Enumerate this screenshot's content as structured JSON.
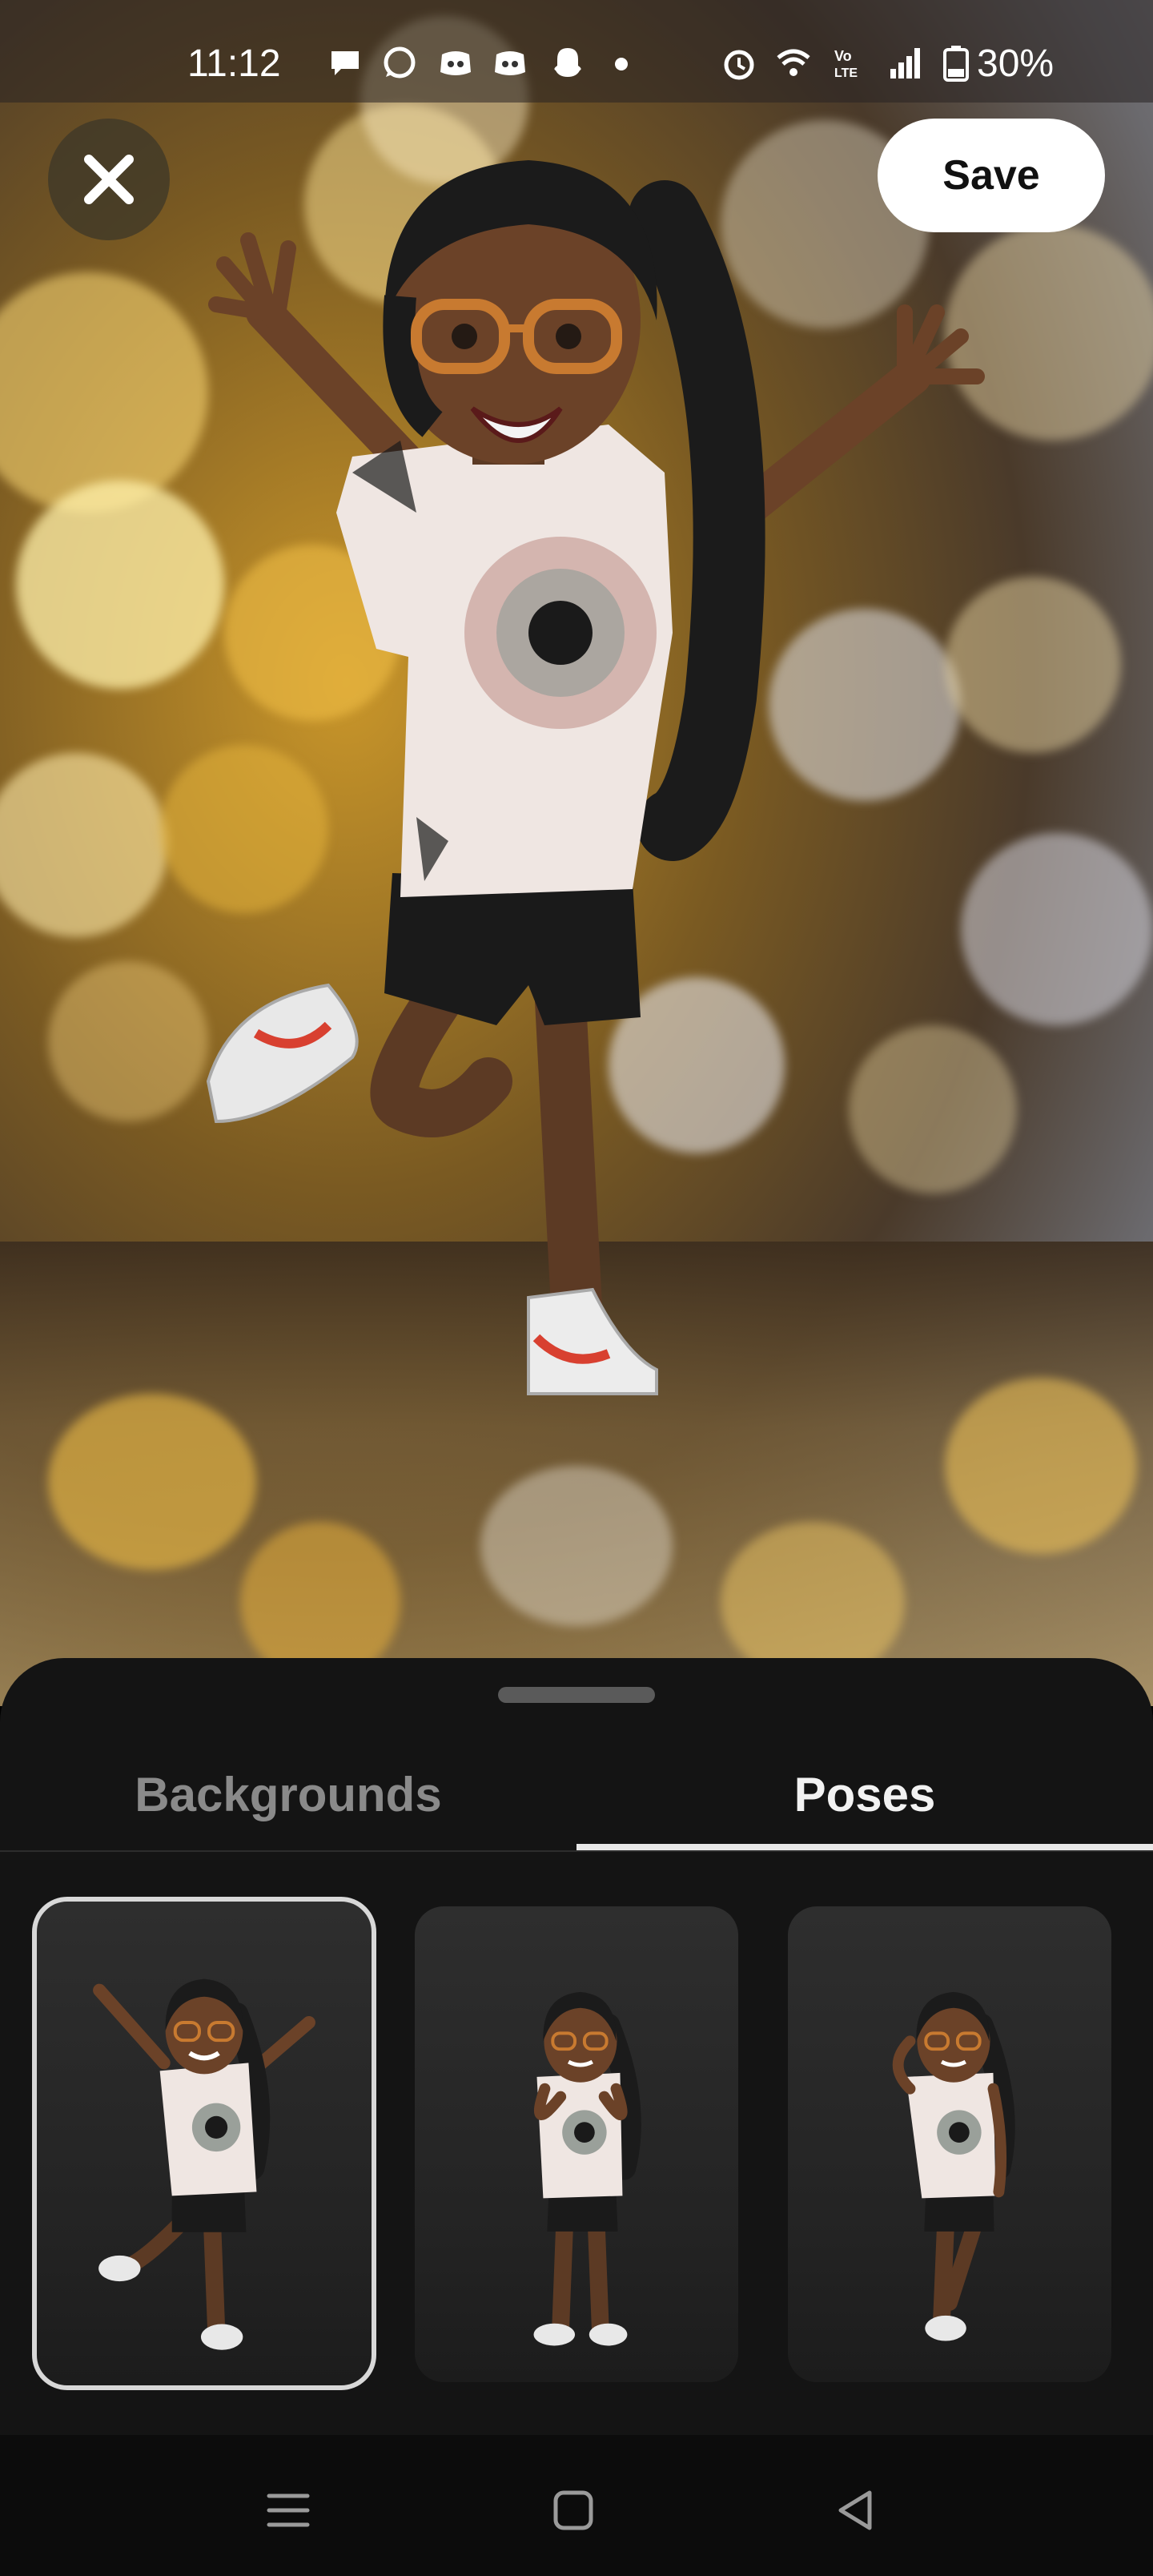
{
  "status_bar": {
    "time": "11:12",
    "battery": "30%",
    "icons": [
      "chat-bubble-icon",
      "whatsapp-icon",
      "discord-icon",
      "discord-icon",
      "snapchat-icon",
      "dot-icon",
      "alarm-icon",
      "wifi-icon",
      "volte-icon",
      "signal-icon",
      "battery-charging-icon"
    ]
  },
  "header": {
    "close_icon": "close-icon",
    "save_label": "Save"
  },
  "sheet": {
    "tabs": [
      {
        "label": "Backgrounds",
        "selected": false
      },
      {
        "label": "Poses",
        "selected": true
      }
    ],
    "poses": [
      {
        "name": "jumping-pose",
        "selected": true
      },
      {
        "name": "hands-together-pose",
        "selected": false
      },
      {
        "name": "peace-sign-pose",
        "selected": false
      }
    ]
  },
  "nav": {
    "buttons": [
      "menu-icon",
      "home-icon",
      "back-icon"
    ]
  },
  "colors": {
    "accent": "#ffffff",
    "sheet_bg": "#141414",
    "bokeh_gold": "#e8b840"
  }
}
